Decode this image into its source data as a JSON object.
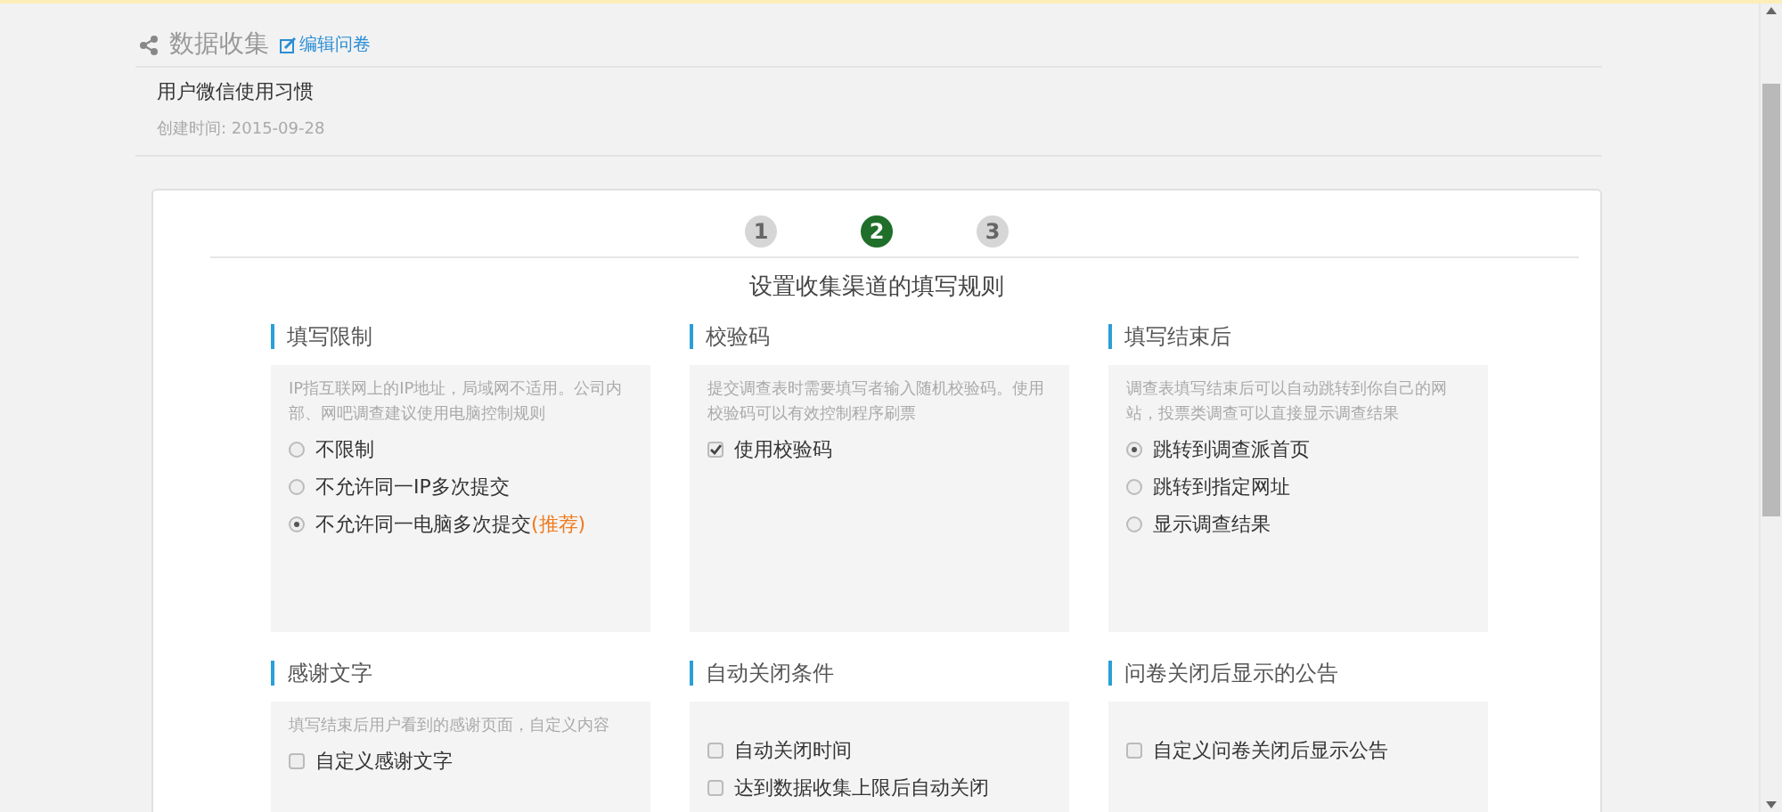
{
  "header": {
    "title": "数据收集",
    "edit_link": "编辑问卷",
    "survey_name": "用户微信使用习惯",
    "created": "创建时间: 2015-09-28"
  },
  "steps": [
    {
      "label": "1",
      "selected": false
    },
    {
      "label": "2",
      "selected": true
    },
    {
      "label": "3",
      "selected": false
    }
  ],
  "subtitle": "设置收集渠道的填写规则",
  "sections": [
    {
      "title": "填写限制",
      "description": "IP指互联网上的IP地址，局域网不适用。公司内部、网吧调查建议使用电脑控制规则",
      "options": [
        {
          "kind": "radio",
          "label": "不限制",
          "checked": false
        },
        {
          "kind": "radio",
          "label": "不允许同一IP多次提交",
          "checked": false
        },
        {
          "kind": "radio",
          "label": "不允许同一电脑多次提交",
          "note": "(推荐)",
          "checked": true
        }
      ]
    },
    {
      "title": "校验码",
      "description": "提交调查表时需要填写者输入随机校验码。使用校验码可以有效控制程序刷票",
      "options": [
        {
          "kind": "checkbox",
          "label": "使用校验码",
          "checked": true
        }
      ]
    },
    {
      "title": "填写结束后",
      "description": "调查表填写结束后可以自动跳转到你自己的网站，投票类调查可以直接显示调查结果",
      "options": [
        {
          "kind": "radio",
          "label": "跳转到调查派首页",
          "checked": true
        },
        {
          "kind": "radio",
          "label": "跳转到指定网址",
          "checked": false
        },
        {
          "kind": "radio",
          "label": "显示调查结果",
          "checked": false
        }
      ]
    },
    {
      "title": "感谢文字",
      "description": "填写结束后用户看到的感谢页面，自定义内容",
      "options": [
        {
          "kind": "checkbox",
          "label": "自定义感谢文字",
          "checked": false
        }
      ]
    },
    {
      "title": "自动关闭条件",
      "options": [
        {
          "kind": "checkbox",
          "label": "自动关闭时间",
          "checked": false
        },
        {
          "kind": "checkbox",
          "label": "达到数据收集上限后自动关闭",
          "checked": false
        }
      ]
    },
    {
      "title": "问卷关闭后显示的公告",
      "options": [
        {
          "kind": "checkbox",
          "label": "自定义问卷关闭后显示公告",
          "checked": false
        }
      ]
    }
  ]
}
